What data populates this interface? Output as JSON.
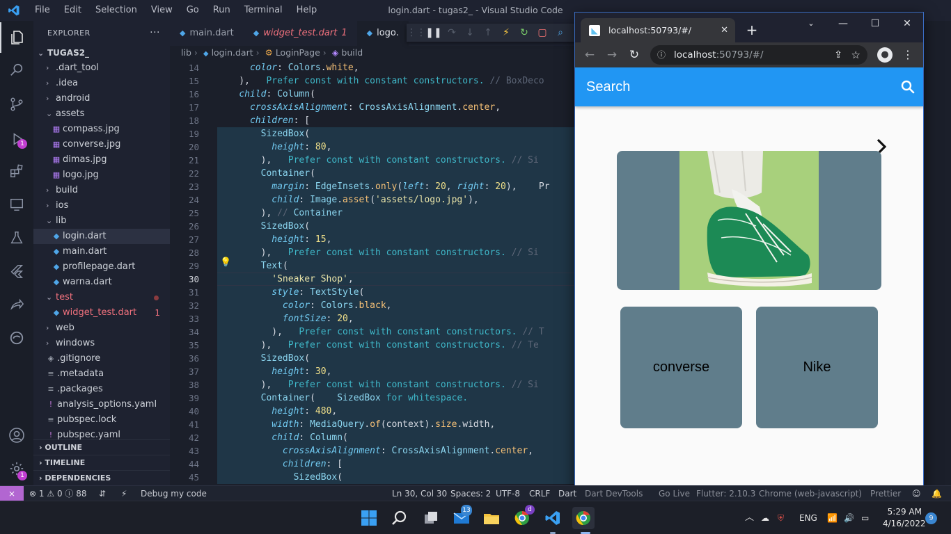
{
  "window": {
    "title": "login.dart - tugas2_ - Visual Studio Code",
    "menu": [
      "File",
      "Edit",
      "Selection",
      "View",
      "Go",
      "Run",
      "Terminal",
      "Help"
    ]
  },
  "activity_bar": {
    "icons": [
      "explorer-icon",
      "search-icon",
      "source-control-icon",
      "run-debug-icon",
      "extensions-icon",
      "remote-explorer-icon",
      "testing-icon",
      "flutter-icon",
      "live-share-icon",
      "edge-devtools-icon",
      "account-icon",
      "settings-gear-icon"
    ],
    "debug_badge": "1",
    "settings_badge": "1"
  },
  "sidebar": {
    "title": "EXPLORER",
    "more": "···",
    "root": "TUGAS2_",
    "items": [
      {
        "label": ".dart_tool",
        "kind": "folder",
        "depth": 1,
        "open": false
      },
      {
        "label": ".idea",
        "kind": "folder",
        "depth": 1,
        "open": false
      },
      {
        "label": "android",
        "kind": "folder",
        "depth": 1,
        "open": false
      },
      {
        "label": "assets",
        "kind": "folder",
        "depth": 1,
        "open": true
      },
      {
        "label": "compass.jpg",
        "kind": "image",
        "depth": 2
      },
      {
        "label": "converse.jpg",
        "kind": "image",
        "depth": 2
      },
      {
        "label": "dimas.jpg",
        "kind": "image",
        "depth": 2
      },
      {
        "label": "logo.jpg",
        "kind": "image",
        "depth": 2
      },
      {
        "label": "build",
        "kind": "folder",
        "depth": 1,
        "open": false
      },
      {
        "label": "ios",
        "kind": "folder",
        "depth": 1,
        "open": false
      },
      {
        "label": "lib",
        "kind": "folder",
        "depth": 1,
        "open": true
      },
      {
        "label": "login.dart",
        "kind": "dart",
        "depth": 2,
        "selected": true
      },
      {
        "label": "main.dart",
        "kind": "dart",
        "depth": 2
      },
      {
        "label": "profilepage.dart",
        "kind": "dart",
        "depth": 2
      },
      {
        "label": "warna.dart",
        "kind": "dart",
        "depth": 2
      },
      {
        "label": "test",
        "kind": "folder",
        "depth": 1,
        "open": true,
        "error": true
      },
      {
        "label": "widget_test.dart",
        "kind": "dart",
        "depth": 2,
        "error": true,
        "count": "1"
      },
      {
        "label": "web",
        "kind": "folder",
        "depth": 1,
        "open": false
      },
      {
        "label": "windows",
        "kind": "folder",
        "depth": 1,
        "open": false
      },
      {
        "label": ".gitignore",
        "kind": "git",
        "depth": 1
      },
      {
        "label": ".metadata",
        "kind": "text",
        "depth": 1
      },
      {
        "label": ".packages",
        "kind": "text",
        "depth": 1
      },
      {
        "label": "analysis_options.yaml",
        "kind": "yaml",
        "depth": 1
      },
      {
        "label": "pubspec.lock",
        "kind": "text",
        "depth": 1
      },
      {
        "label": "pubspec.yaml",
        "kind": "yaml",
        "depth": 1
      }
    ],
    "sections": [
      "OUTLINE",
      "TIMELINE",
      "DEPENDENCIES"
    ]
  },
  "editor": {
    "tabs": [
      {
        "label": "main.dart",
        "state": "normal"
      },
      {
        "label": "widget_test.dart",
        "state": "error",
        "count": "1"
      },
      {
        "label": "logo.",
        "state": "active"
      }
    ],
    "tab_overflow": "ogo.",
    "breadcrumb": [
      "lib",
      "login.dart",
      "LoginPage",
      "build"
    ],
    "debug_toolbar": [
      "drag-handle-icon",
      "pause-icon",
      "step-over-icon",
      "step-into-icon",
      "step-out-icon",
      "hot-reload-icon",
      "hot-restart-icon",
      "stop-icon",
      "devtools-search-icon"
    ],
    "current_line": "30",
    "lines": [
      {
        "no": "14",
        "text": "      color: Colors.white,"
      },
      {
        "no": "15",
        "text": "    ),   Prefer const with constant constructors. // BoxDeco"
      },
      {
        "no": "16",
        "text": "    child: Column("
      },
      {
        "no": "17",
        "text": "      crossAxisAlignment: CrossAxisAlignment.center,"
      },
      {
        "no": "18",
        "text": "      children: ["
      },
      {
        "no": "19",
        "text": "        SizedBox("
      },
      {
        "no": "20",
        "text": "          height: 80,"
      },
      {
        "no": "21",
        "text": "        ),   Prefer const with constant constructors. // Si"
      },
      {
        "no": "22",
        "text": "        Container("
      },
      {
        "no": "23",
        "text": "          margin: EdgeInsets.only(left: 20, right: 20),    Pr"
      },
      {
        "no": "24",
        "text": "          child: Image.asset('assets/logo.jpg'),"
      },
      {
        "no": "25",
        "text": "        ), // Container"
      },
      {
        "no": "26",
        "text": "        SizedBox("
      },
      {
        "no": "27",
        "text": "          height: 15,"
      },
      {
        "no": "28",
        "text": "        ),   Prefer const with constant constructors. // Si"
      },
      {
        "no": "29",
        "text": "        Text("
      },
      {
        "no": "30",
        "text": "          'Sneaker Shop',"
      },
      {
        "no": "31",
        "text": "          style: TextStyle("
      },
      {
        "no": "32",
        "text": "            color: Colors.black,"
      },
      {
        "no": "33",
        "text": "            fontSize: 20,"
      },
      {
        "no": "34",
        "text": "          ),   Prefer const with constant constructors. // T"
      },
      {
        "no": "35",
        "text": "        ),   Prefer const with constant constructors. // Te"
      },
      {
        "no": "36",
        "text": "        SizedBox("
      },
      {
        "no": "37",
        "text": "          height: 30,"
      },
      {
        "no": "38",
        "text": "        ),   Prefer const with constant constructors. // Si"
      },
      {
        "no": "39",
        "text": "        Container(    SizedBox for whitespace."
      },
      {
        "no": "40",
        "text": "          height: 480,"
      },
      {
        "no": "41",
        "text": "          width: MediaQuery.of(context).size.width,"
      },
      {
        "no": "42",
        "text": "          child: Column("
      },
      {
        "no": "43",
        "text": "            crossAxisAlignment: CrossAxisAlignment.center,"
      },
      {
        "no": "44",
        "text": "            children: ["
      },
      {
        "no": "45",
        "text": "              SizedBox("
      }
    ]
  },
  "status_bar": {
    "errors": "1",
    "warnings": "0",
    "infos": "88",
    "debug": "Debug my code",
    "position": "Ln 30, Col 30",
    "spaces": "Spaces: 2",
    "encoding": "UTF-8",
    "eol": "CRLF",
    "language": "Dart",
    "extras": [
      "Dart DevTools",
      "Go Live",
      "Flutter: 2.10.3",
      "Chrome (web-javascript)",
      "Prettier"
    ]
  },
  "browser": {
    "tab_title": "localhost:50793/#/",
    "address_host": "localhost",
    "address_path": ":50793/#/",
    "app": {
      "appbar_title": "Search",
      "cards": [
        "converse",
        "Nike"
      ],
      "colors": {
        "appbar": "#2196f3",
        "card": "#607d8b",
        "background": "#fafafa"
      }
    }
  },
  "taskbar": {
    "mail_badge": "13",
    "chrome_profile_badge": "d",
    "language": "ENG",
    "time": "5:29 AM",
    "date": "4/16/2022",
    "notifications": "9"
  }
}
